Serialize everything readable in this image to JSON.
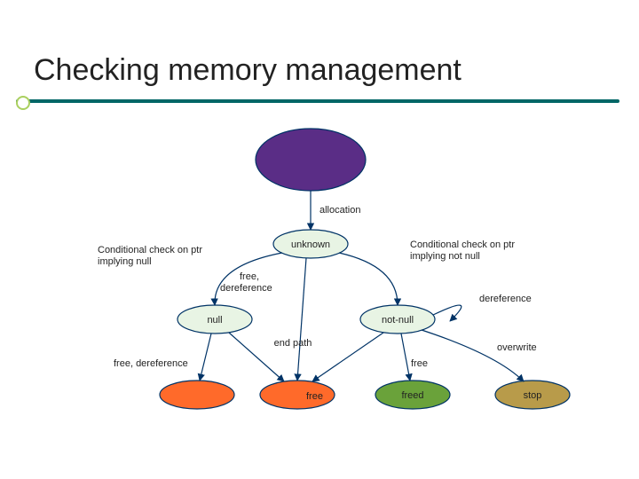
{
  "title": "Checking memory management",
  "nodes": {
    "start": "",
    "unknown": "unknown",
    "null": "null",
    "notnull": "not-null",
    "freed": "freed",
    "stop": "stop",
    "errmid": "",
    "errleft": ""
  },
  "edges": {
    "allocation": "allocation",
    "cond_null_a": "Conditional check on ptr",
    "cond_null_b": "implying null",
    "cond_notnull_a": "Conditional check on ptr",
    "cond_notnull_b": "implying not null",
    "free_deref_a": "free,",
    "free_deref_b": "dereference",
    "dereference": "dereference",
    "end_path": "end path",
    "overwrite": "overwrite",
    "free_deref_inline": "free, dereference",
    "free_mid": "free",
    "free_right": "free"
  },
  "colors": {
    "start_fill": "#5a2d86",
    "err_fill": "#ff6a2a",
    "freed_fill": "#6aa23a",
    "stop_fill": "#b89b4a",
    "pale_fill": "#e8f4e4",
    "stroke": "#003366"
  }
}
